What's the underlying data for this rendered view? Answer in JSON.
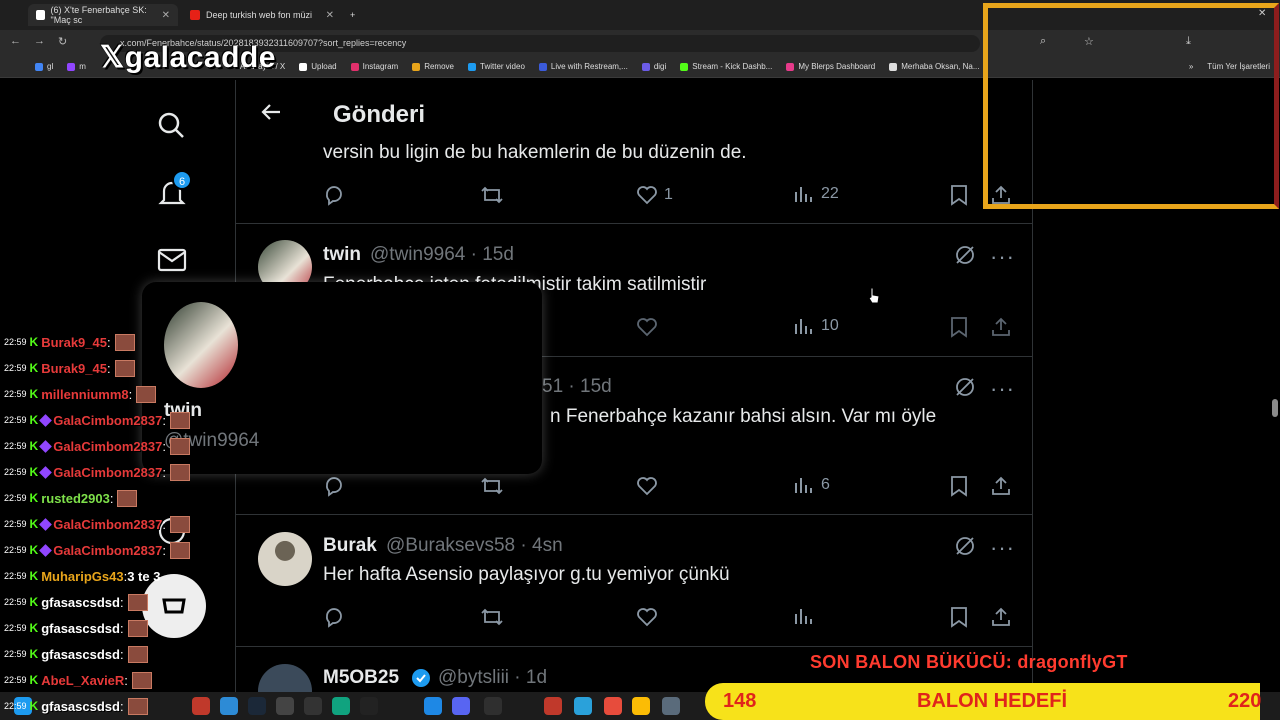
{
  "browser": {
    "tabs": [
      {
        "title": "(6) X'te Fenerbahçe SK: \"Maç sc",
        "active": true
      },
      {
        "title": "Deep turkish web fon müzi",
        "active": false
      }
    ],
    "new_tab": "+",
    "url": "x.com/Fenerbahce/status/2028183932311609707?sort_replies=recency",
    "bookmarks": [
      "gl",
      "m",
      "Anasayfa / X",
      "Upload",
      "Instagram",
      "Remove",
      "Twitter video",
      "Live with Restream,...",
      "digi",
      "Stream - Kick Dashb...",
      "My Blerps Dashboard",
      "Merhaba Oksan, Na..."
    ],
    "bookmarks_more": "»",
    "all_bookmarks": "Tüm Yer İşaretleri"
  },
  "overlay": {
    "logo": "galacadde",
    "balon_top": "SON BALON BÜKÜCÜ: dragonflyGT",
    "balon_count": "148",
    "balon_goal": "BALON HEDEFİ",
    "balon_target": "220"
  },
  "sidebar": {
    "notification_count": "6"
  },
  "header": {
    "title": "Gönderi"
  },
  "tweets": [
    {
      "text": "versin bu ligin de bu hakemlerin de bu düzenin de.",
      "likes": "1",
      "views": "22"
    },
    {
      "name": "twin",
      "handle": "@twin9964 · 15d",
      "text": "Fenerbahçe isten fetedilmistir takim satilmistir",
      "views": "10"
    },
    {
      "handle": "51 · 15d",
      "text": "n Fenerbahçe kazanır bahsi alsın. Var mı öyle",
      "views": "6"
    },
    {
      "name": "Burak",
      "handle": "@Buraksevs58 · 4sn",
      "text": "Her hafta Asensio paylaşıyor g.tu yemiyor çünkü"
    },
    {
      "name": "M5OB25",
      "handle": "@bytsliii · 1d"
    }
  ],
  "hovercard": {
    "name": "twin",
    "handle": "@twin9964"
  },
  "chat": [
    {
      "time": "22:59",
      "user": "Burak9_45",
      "color": "#e63a3a",
      "msg": ""
    },
    {
      "time": "22:59",
      "user": "Burak9_45",
      "color": "#e63a3a",
      "msg": ""
    },
    {
      "time": "22:59",
      "user": "millenniumm8",
      "color": "#e63a3a",
      "msg": ""
    },
    {
      "time": "22:59",
      "user": "GalaCimbom2837",
      "color": "#e63a3a",
      "msg": ""
    },
    {
      "time": "22:59",
      "user": "GalaCimbom2837",
      "color": "#e63a3a",
      "msg": ""
    },
    {
      "time": "22:59",
      "user": "GalaCimbom2837",
      "color": "#e63a3a",
      "msg": ""
    },
    {
      "time": "22:59",
      "user": "rusted2903",
      "color": "#7ee04a",
      "msg": ""
    },
    {
      "time": "22:59",
      "user": "GalaCimbom2837",
      "color": "#e63a3a",
      "msg": ""
    },
    {
      "time": "22:59",
      "user": "GalaCimbom2837",
      "color": "#e63a3a",
      "msg": ""
    },
    {
      "time": "22:59",
      "user": "MuharipGs43",
      "color": "#e8a51b",
      "msg": "3 te 3"
    },
    {
      "time": "22:59",
      "user": "gfasascsdsd",
      "color": "#ffffff",
      "msg": ""
    },
    {
      "time": "22:59",
      "user": "gfasascsdsd",
      "color": "#ffffff",
      "msg": ""
    },
    {
      "time": "22:59",
      "user": "gfasascsdsd",
      "color": "#ffffff",
      "msg": ""
    },
    {
      "time": "22:59",
      "user": "AbeL_XavieR",
      "color": "#e63a3a",
      "msg": ""
    },
    {
      "time": "22:59",
      "user": "gfasascsdsd",
      "color": "#ffffff",
      "msg": ""
    }
  ],
  "colors": {
    "accent": "#1d9bf0",
    "text_primary": "#e7e9ea",
    "text_secondary": "#71767b",
    "balon_bar": "#f7e21a",
    "balon_text": "#e0241b"
  }
}
